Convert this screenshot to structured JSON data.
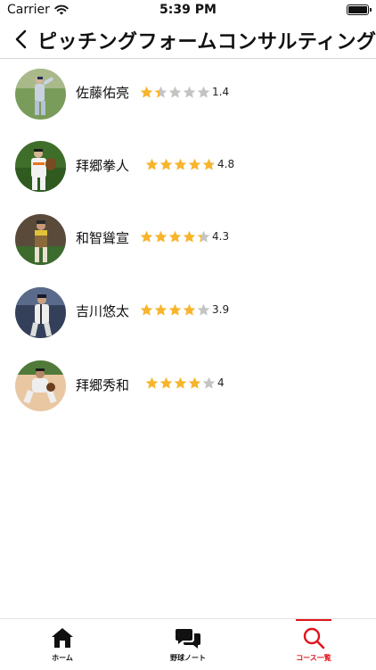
{
  "status_bar": {
    "carrier": "Carrier",
    "time": "5:39 PM"
  },
  "nav": {
    "title": "ピッチングフォームコンサルティングコース"
  },
  "players": [
    {
      "name": "佐藤佑亮",
      "rating": 1.4,
      "rating_label": "1.4"
    },
    {
      "name": "拜郷拳人",
      "rating": 4.8,
      "rating_label": "4.8"
    },
    {
      "name": "和智聳宣",
      "rating": 4.3,
      "rating_label": "4.3"
    },
    {
      "name": "吉川悠太",
      "rating": 3.9,
      "rating_label": "3.9"
    },
    {
      "name": "拜郷秀和",
      "rating": 4.0,
      "rating_label": "4"
    }
  ],
  "tabs": [
    {
      "label": "ホーム",
      "icon": "home-icon"
    },
    {
      "label": "野球ノート",
      "icon": "chat-bubbles-icon"
    },
    {
      "label": "コース一覧",
      "icon": "search-icon",
      "active": true
    }
  ],
  "colors": {
    "star_filled": "#f7b52c",
    "star_empty": "#c4c4c4",
    "active_tab": "#e0141b"
  }
}
